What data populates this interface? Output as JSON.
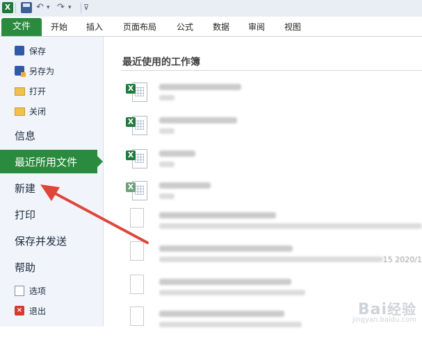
{
  "qat": {
    "app_icon": "X",
    "save_icon": "save-icon",
    "undo_glyph": "↶",
    "redo_glyph": "↷",
    "dropdown_glyph": "▾",
    "customize_glyph": "⊽"
  },
  "ribbon": {
    "file_tab": "文件",
    "tabs": [
      "开始",
      "插入",
      "页面布局",
      "公式",
      "数据",
      "审阅",
      "视图"
    ]
  },
  "nav": {
    "save": "保存",
    "save_as": "另存为",
    "open": "打开",
    "close": "关闭",
    "info": "信息",
    "recent": "最近所用文件",
    "new": "新建",
    "print": "打印",
    "save_send": "保存并发送",
    "help": "帮助",
    "options": "选项",
    "exit": "退出"
  },
  "main": {
    "title": "最近使用的工作簿",
    "visible_date_fragment": "15 2020/1"
  },
  "watermark": {
    "brand_latin": "Bai",
    "brand_cn": "经验",
    "url": "jingyan.baidu.com"
  },
  "colors": {
    "accent_green": "#2a8a3d",
    "annotation_red": "#e0453a"
  }
}
